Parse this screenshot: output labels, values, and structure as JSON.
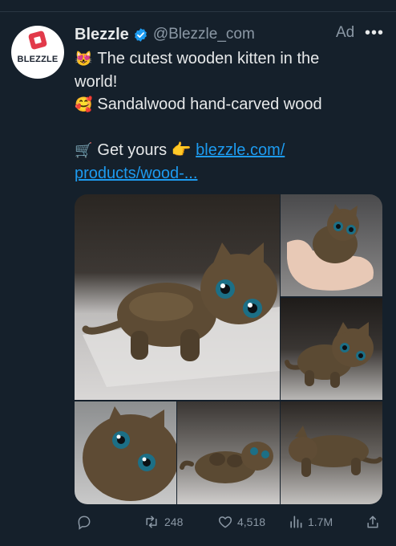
{
  "post": {
    "avatar_text": "BLEZZLE",
    "name": "Blezzle",
    "handle": "@Blezzle_com",
    "ad_label": "Ad",
    "more_label": "•••",
    "lines": [
      {
        "emoji": "😻",
        "text": "The cutest wooden kitten in the"
      },
      {
        "emoji": "",
        "text": "world!"
      },
      {
        "emoji": "🥰",
        "text": "Sandalwood hand-carved wood"
      },
      {
        "emoji": "",
        "text": ""
      },
      {
        "emoji": "🛒",
        "text": "Get yours 👉 ",
        "link": "blezzle.com/"
      },
      {
        "emoji": "",
        "text": "",
        "link": "products/wood-..."
      }
    ]
  },
  "icons": {
    "verified": "verified-badge-icon",
    "reply": "reply-icon",
    "retweet": "retweet-icon",
    "like": "heart-icon",
    "views": "views-bar-chart-icon",
    "share": "share-upload-icon"
  },
  "colors": {
    "background": "#15202b",
    "text": "#e7e9ea",
    "secondary": "#8b98a5",
    "link": "#1d9bf0",
    "brand_red": "#e23a4a"
  },
  "stats": {
    "retweets": "248",
    "likes": "4,518",
    "views": "1.7M"
  }
}
